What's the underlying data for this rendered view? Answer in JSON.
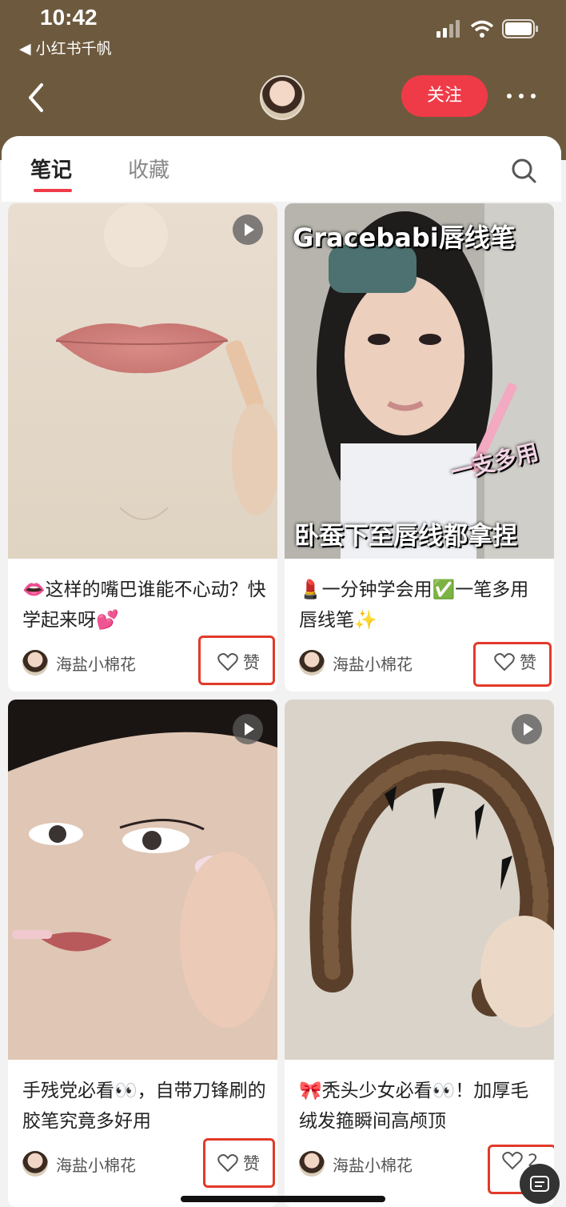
{
  "status_bar": {
    "time": "10:42",
    "back_app": "◀ 小红书千帆"
  },
  "header": {
    "follow_label": "关注"
  },
  "tabs": [
    {
      "label": "笔记"
    },
    {
      "label": "收藏"
    }
  ],
  "cards": [
    {
      "title": "👄这样的嘴巴谁能不心动？快学起来呀💕",
      "author": "海盐小棉花",
      "like_label": "赞",
      "overlay": "",
      "has_play": true
    },
    {
      "title": "💄一分钟学会用✅一笔多用唇线笔✨",
      "author": "海盐小棉花",
      "like_label": "赞",
      "overlay_top": "Gracebabi唇线笔",
      "overlay_mid": "一支多用",
      "overlay_bottom": "卧蚕下至唇线都拿捏",
      "has_play": false
    },
    {
      "title": "手残党必看👀，自带刀锋刷的胶笔究竟多好用",
      "author": "海盐小棉花",
      "like_label": "赞",
      "has_play": true
    },
    {
      "title": "🎀秃头少女必看👀！加厚毛绒发箍瞬间高颅顶",
      "author": "海盐小棉花",
      "like_label": "2",
      "has_play": true
    }
  ],
  "colors": {
    "header_bg": "#6d5a3e",
    "accent": "#ef3b48",
    "highlight": "#e23a2a"
  }
}
